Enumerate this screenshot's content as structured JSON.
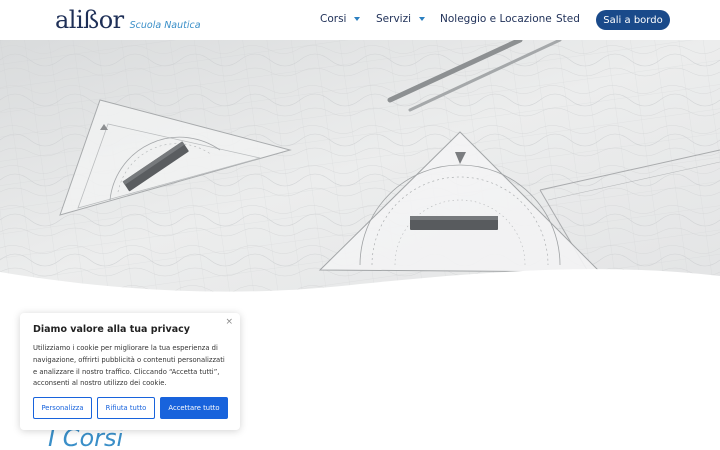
{
  "header": {
    "logo_text": "alißor",
    "logo_tagline": "Scuola Nautica",
    "nav": [
      {
        "label": "Corsi",
        "has_dropdown": true
      },
      {
        "label": "Servizi",
        "has_dropdown": true
      },
      {
        "label": "Noleggio e Locazione",
        "has_dropdown": false
      },
      {
        "label": "Sted",
        "has_dropdown": false
      }
    ],
    "cta_label": "Sali a bordo"
  },
  "hero": {
    "image": "nautical chart with triangle protractors and pencils"
  },
  "main": {
    "section_title": "I Corsi"
  },
  "cookie_banner": {
    "title": "Diamo valore alla tua privacy",
    "text": "Utilizziamo i cookie per migliorare la tua esperienza di navigazione, offrirti pubblicità o contenuti personalizzati e analizzare il nostro traffico. Cliccando “Accetta tutti”, acconsenti al nostro utilizzo dei cookie.",
    "close_label": "×",
    "buttons": {
      "customize": "Personalizza",
      "reject": "Rifiuta tutto",
      "accept": "Accettare tutto"
    }
  },
  "colors": {
    "navy": "#1e2f57",
    "accent_blue": "#3a8fc8",
    "cta_bg": "#1a4a8a",
    "cookie_blue": "#1863dc"
  }
}
